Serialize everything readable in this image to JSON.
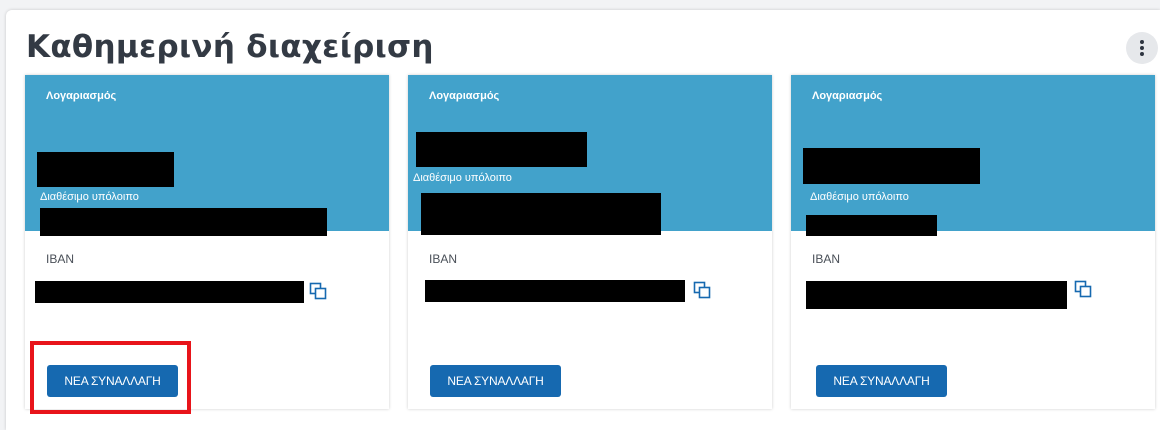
{
  "section": {
    "title": "Καθημερινή διαχείριση",
    "more_icon": "more-vertical-icon"
  },
  "cards": [
    {
      "account_label": "Λογαριασμός",
      "balance_label": "Διαθέσιμο υπόλοιπο",
      "iban_label": "IBAN",
      "copy_icon": "copy-icon",
      "action_label": "ΝΕΑ ΣΥΝΑΛΛΑΓΗ"
    },
    {
      "account_label": "Λογαριασμός",
      "balance_label": "Διαθέσιμο υπόλοιπο",
      "iban_label": "IBAN",
      "copy_icon": "copy-icon",
      "action_label": "ΝΕΑ ΣΥΝΑΛΛΑΓΗ"
    },
    {
      "account_label": "Λογαριασμός",
      "balance_label": "Διαθέσιμο υπόλοιπο",
      "iban_label": "IBAN",
      "copy_icon": "copy-icon",
      "action_label": "ΝΕΑ ΣΥΝΑΛΛΑΓΗ"
    }
  ],
  "colors": {
    "card_header": "#42a2cb",
    "button": "#1669b0",
    "highlight": "#e8141a",
    "title": "#333a44"
  }
}
